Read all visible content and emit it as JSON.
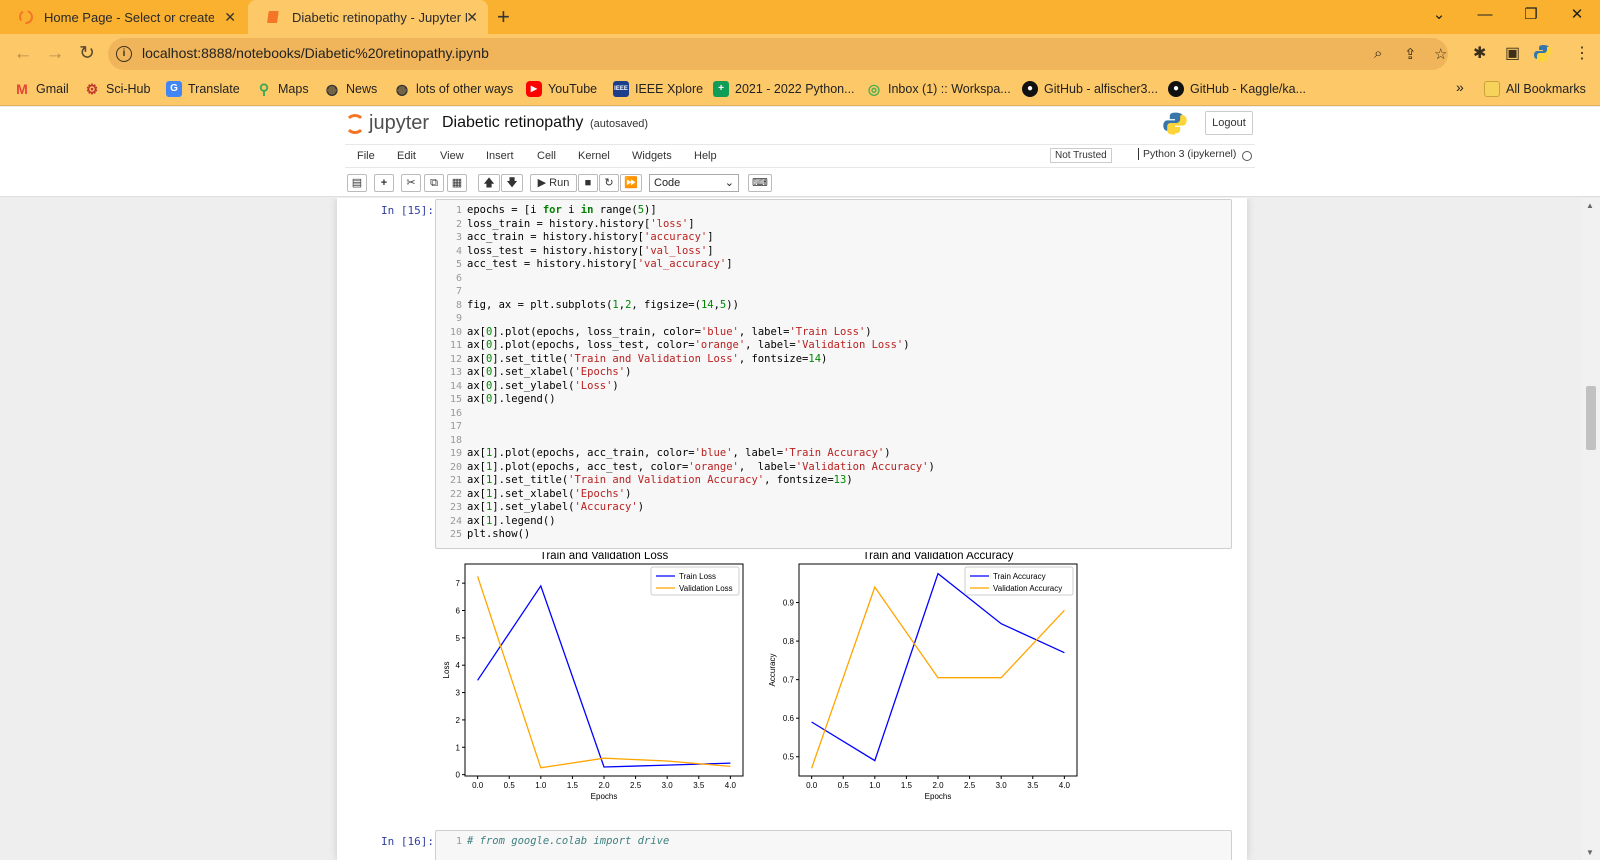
{
  "browser": {
    "tabs": [
      {
        "title": "Home Page - Select or create a notebook",
        "active": false
      },
      {
        "title": "Diabetic retinopathy - Jupyter Notebook",
        "active": true
      }
    ],
    "url": "localhost:8888/notebooks/Diabetic%20retinopathy.ipynb",
    "bookmarks": [
      {
        "label": "Gmail",
        "icon": "gmail-icon",
        "color": "#ea4335"
      },
      {
        "label": "Sci-Hub",
        "icon": "scihub-icon",
        "color": "#c0392b"
      },
      {
        "label": "Translate",
        "icon": "translate-icon",
        "color": "#4285f4"
      },
      {
        "label": "Maps",
        "icon": "maps-icon",
        "color": "#34a853"
      },
      {
        "label": "News",
        "icon": "globe-icon",
        "color": "#333333"
      },
      {
        "label": "lots of other ways",
        "icon": "globe-icon",
        "color": "#333333"
      },
      {
        "label": "YouTube",
        "icon": "youtube-icon",
        "color": "#ff0000"
      },
      {
        "label": "IEEE Xplore",
        "icon": "ieee-icon",
        "color": "#1b3f8b"
      },
      {
        "label": "2021 - 2022 Python...",
        "icon": "sheets-icon",
        "color": "#0f9d58"
      },
      {
        "label": "Inbox (1) :: Workspa...",
        "icon": "mail-icon",
        "color": "#4caf50"
      },
      {
        "label": "GitHub - alfischer3...",
        "icon": "github-icon",
        "color": "#111111"
      },
      {
        "label": "GitHub - Kaggle/ka...",
        "icon": "github-icon",
        "color": "#111111"
      }
    ],
    "more": "»",
    "all_bookmarks": "All Bookmarks"
  },
  "jupyter": {
    "logo_text": "jupyter",
    "notebook_name": "Diabetic retinopathy",
    "autosave": "(autosaved)",
    "logout": "Logout",
    "menus": [
      "File",
      "Edit",
      "View",
      "Insert",
      "Cell",
      "Kernel",
      "Widgets",
      "Help"
    ],
    "trust": "Not Trusted",
    "kernel": "Python 3 (ipykernel)",
    "run_label": "Run",
    "cell_type": "Code"
  },
  "cells": [
    {
      "prompt": "In [15]:",
      "lines": [
        "epochs = [i for i in range(5)]",
        "loss_train = history.history['loss']",
        "acc_train = history.history['accuracy']",
        "loss_test = history.history['val_loss']",
        "acc_test = history.history['val_accuracy']",
        "",
        "",
        "fig, ax = plt.subplots(1,2, figsize=(14,5))",
        "",
        "ax[0].plot(epochs, loss_train, color='blue', label='Train Loss')",
        "ax[0].plot(epochs, loss_test, color='orange', label='Validation Loss')",
        "ax[0].set_title('Train and Validation Loss', fontsize=14)",
        "ax[0].set_xlabel('Epochs')",
        "ax[0].set_ylabel('Loss')",
        "ax[0].legend()",
        "",
        "",
        "",
        "ax[1].plot(epochs, acc_train, color='blue', label='Train Accuracy')",
        "ax[1].plot(epochs, acc_test, color='orange',  label='Validation Accuracy')",
        "ax[1].set_title('Train and Validation Accuracy', fontsize=13)",
        "ax[1].set_xlabel('Epochs')",
        "ax[1].set_ylabel('Accuracy')",
        "ax[1].legend()",
        "plt.show()"
      ]
    },
    {
      "prompt": "In [16]:",
      "lines": [
        "# from google.colab import drive"
      ]
    }
  ],
  "chart_data": [
    {
      "type": "line",
      "title": "Train and Validation Loss",
      "xlabel": "Epochs",
      "ylabel": "Loss",
      "x": [
        0,
        1,
        2,
        3,
        4
      ],
      "xlim": [
        -0.2,
        4.2
      ],
      "ylim": [
        -0.05,
        7.7
      ],
      "xticks": [
        "0.0",
        "0.5",
        "1.0",
        "1.5",
        "2.0",
        "2.5",
        "3.0",
        "3.5",
        "4.0"
      ],
      "yticks": [
        "0",
        "1",
        "2",
        "3",
        "4",
        "5",
        "6",
        "7"
      ],
      "legend": "top-right",
      "series": [
        {
          "name": "Train Loss",
          "color": "#0000ff",
          "values": [
            3.45,
            6.9,
            0.28,
            0.35,
            0.42
          ]
        },
        {
          "name": "Validation Loss",
          "color": "#ffa500",
          "values": [
            7.25,
            0.25,
            0.6,
            0.5,
            0.3
          ]
        }
      ]
    },
    {
      "type": "line",
      "title": "Train and Validation Accuracy",
      "xlabel": "Epochs",
      "ylabel": "Accuracy",
      "x": [
        0,
        1,
        2,
        3,
        4
      ],
      "xlim": [
        -0.2,
        4.2
      ],
      "ylim": [
        0.45,
        1.0
      ],
      "xticks": [
        "0.0",
        "0.5",
        "1.0",
        "1.5",
        "2.0",
        "2.5",
        "3.0",
        "3.5",
        "4.0"
      ],
      "yticks": [
        "0.5",
        "0.6",
        "0.7",
        "0.8",
        "0.9"
      ],
      "legend": "top-right",
      "series": [
        {
          "name": "Train Accuracy",
          "color": "#0000ff",
          "values": [
            0.59,
            0.49,
            0.975,
            0.845,
            0.77
          ]
        },
        {
          "name": "Validation Accuracy",
          "color": "#ffa500",
          "values": [
            0.47,
            0.94,
            0.705,
            0.705,
            0.88
          ]
        }
      ]
    }
  ]
}
